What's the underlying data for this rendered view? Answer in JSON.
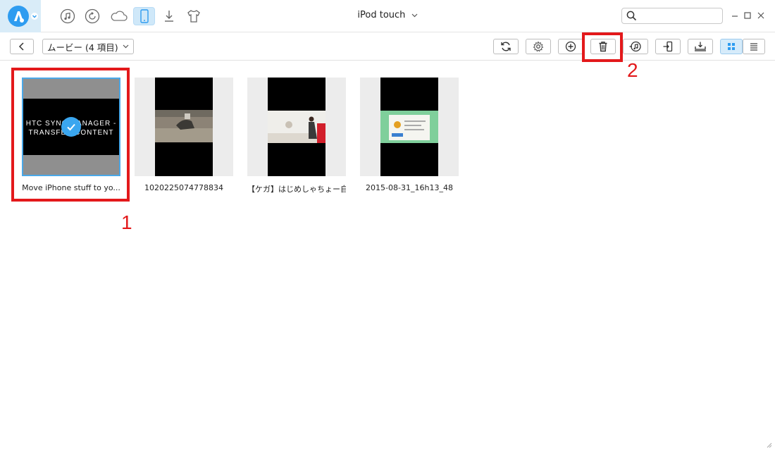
{
  "window": {
    "device_title": "iPod touch"
  },
  "nav": [
    {
      "icon": "music-note-icon",
      "active": false
    },
    {
      "icon": "history-icon",
      "active": false
    },
    {
      "icon": "cloud-icon",
      "active": false
    },
    {
      "icon": "phone-icon",
      "active": true
    },
    {
      "icon": "download-icon",
      "active": false
    },
    {
      "icon": "tshirt-icon",
      "active": false
    }
  ],
  "search": {
    "value": "",
    "placeholder": ""
  },
  "toolbar": {
    "category_label": "ムービー (4 項目)"
  },
  "annotations": {
    "step1": "1",
    "step2": "2"
  },
  "videos": [
    {
      "caption": "Move iPhone stuff to yo...",
      "selected": true,
      "thumb_text_1": "HTC SYNC MANAGER -",
      "thumb_text_2": "TRANSFER CONTENT"
    },
    {
      "caption": "1020225074778834",
      "selected": false
    },
    {
      "caption": "【ケガ】はじめしゃちょー自分...",
      "selected": false
    },
    {
      "caption": "2015-08-31_16h13_48",
      "selected": false
    }
  ],
  "colors": {
    "accent": "#2e9cf0",
    "highlight": "#e3191b",
    "selection": "#4aa8e8"
  }
}
